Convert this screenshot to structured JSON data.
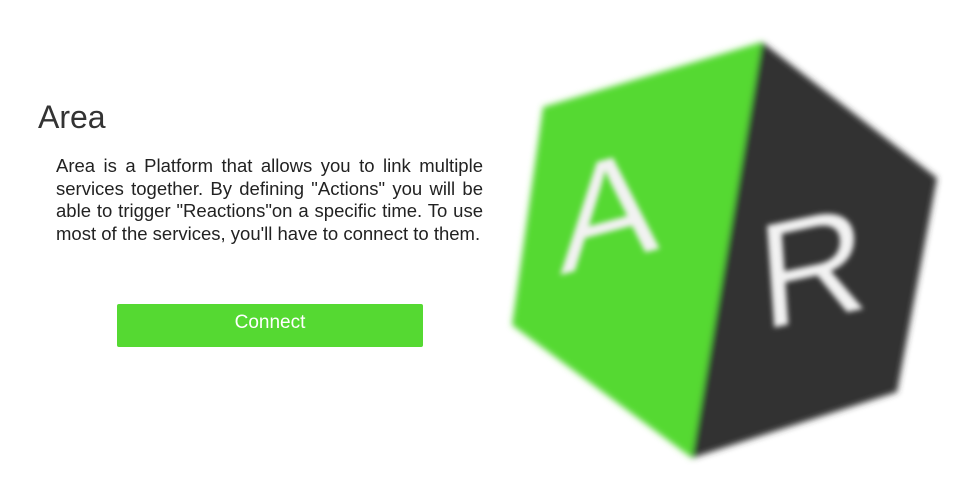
{
  "app": {
    "title": "Area",
    "description": "Area is a Platform that allows you to link multiple services together. By defining \"Actions\" you will be able to trigger \"Reactions\"on a specific time. To use most of the services, you'll have to connect to them.",
    "connect_label": "Connect"
  },
  "logo": {
    "left_letter": "A",
    "right_letter": "R",
    "colors": {
      "green_face": "#55d932",
      "dark_face": "#333333",
      "letter": "#f2f2f2"
    }
  },
  "colors": {
    "accent": "#55d932",
    "title_text": "#333333",
    "body_text": "#222222"
  }
}
